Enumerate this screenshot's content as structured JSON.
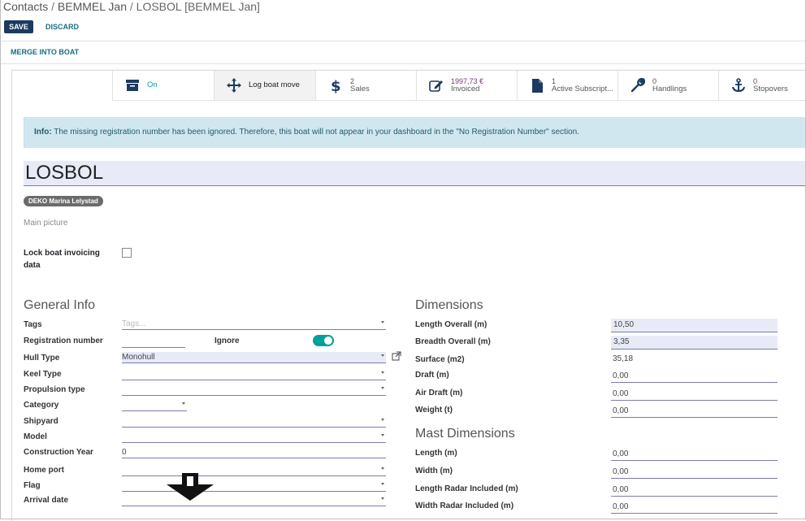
{
  "breadcrumb": {
    "root": "Contacts",
    "sep1": " / ",
    "contact": "BEMMEL Jan",
    "sep2": " / ",
    "current": "LOSBOL [BEMMEL Jan]"
  },
  "actions": {
    "save": "SAVE",
    "discard": "DISCARD",
    "merge": "MERGE INTO BOAT"
  },
  "stats": [
    {
      "icon": "archive-icon",
      "label": "On",
      "num": ""
    },
    {
      "icon": "move-arrows-icon",
      "label": "Log boat move",
      "num": ""
    },
    {
      "icon": "dollar-icon",
      "label": "Sales",
      "num": "2"
    },
    {
      "icon": "pencil-square-icon",
      "label": "Invoiced",
      "num": "1997,73 €"
    },
    {
      "icon": "file-icon",
      "label": "Active Subscript...",
      "num": "1"
    },
    {
      "icon": "wrench-icon",
      "label": "Handlings",
      "num": "0"
    },
    {
      "icon": "anchor-icon",
      "label": "Stopovers",
      "num": "0"
    }
  ],
  "info": {
    "prefix": "Info:",
    "text": " The missing registration number has been ignored. Therefore, this boat will not appear in your dashboard in the \"No Registration Number\" section."
  },
  "boat": {
    "name": "LOSBOL",
    "badge": "DEKO Marina Lelystad",
    "main_picture": "Main picture",
    "lock_label": "Lock boat invoicing data"
  },
  "general": {
    "title": "General Info",
    "tags_label": "Tags",
    "tags_placeholder": "Tags...",
    "reg_label": "Registration number",
    "ignore_label": "Ignore",
    "hull_label": "Hull Type",
    "hull_value": "Monohull",
    "keel_label": "Keel Type",
    "prop_label": "Propulsion type",
    "cat_label": "Category",
    "shipyard_label": "Shipyard",
    "model_label": "Model",
    "year_label": "Construction Year",
    "year_value": "0",
    "home_label": "Home port",
    "flag_label": "Flag",
    "arrival_label": "Arrival date"
  },
  "dimensions": {
    "title": "Dimensions",
    "loa_label": "Length Overall (m)",
    "loa_value": "10,50",
    "boa_label": "Breadth Overall (m)",
    "boa_value": "3,35",
    "surface_label": "Surface (m2)",
    "surface_value": "35,18",
    "draft_label": "Draft (m)",
    "draft_value": "0,00",
    "air_label": "Air Draft (m)",
    "air_value": "0,00",
    "weight_label": "Weight (t)",
    "weight_value": "0,00"
  },
  "mast": {
    "title": "Mast Dimensions",
    "len_label": "Length (m)",
    "len_value": "0,00",
    "wid_label": "Width (m)",
    "wid_value": "0,00",
    "lri_label": "Length Radar Included (m)",
    "lri_value": "0,00",
    "wri_label": "Width Radar Included (m)",
    "wri_value": "0,00"
  }
}
